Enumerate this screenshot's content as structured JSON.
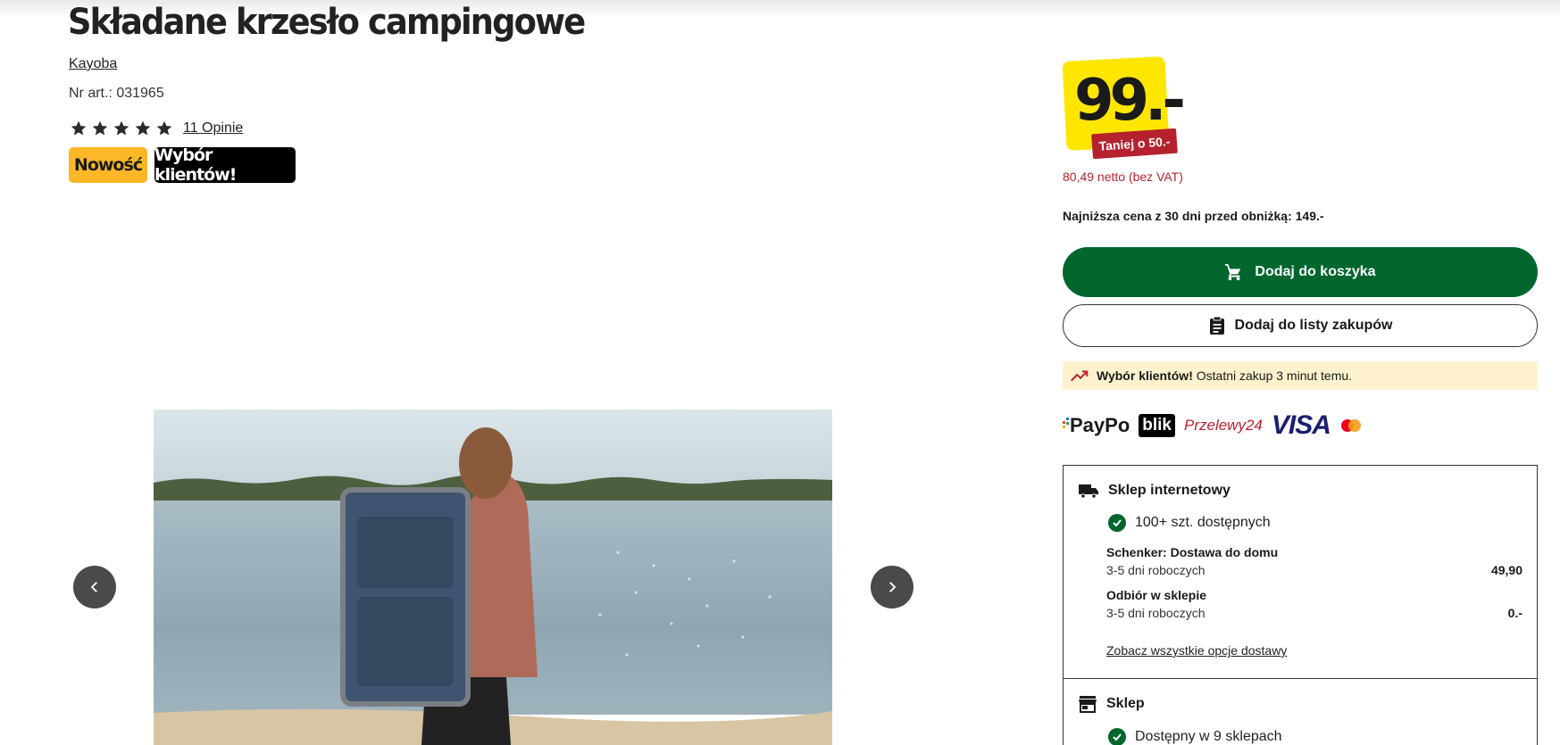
{
  "product": {
    "title": "Składane krzesło campingowe",
    "brand": "Kayoba",
    "article_number": "Nr art.: 031965",
    "rating": 5,
    "reviews_label": "11 Opinie",
    "badges": {
      "new": "Nowość",
      "choice": "Wybór klientów!"
    }
  },
  "price": {
    "value": "99.-",
    "cheaper_label": "Taniej o 50.-",
    "netto": "80,49 netto (bez VAT)",
    "lowest_30_days": "Najniższa cena z 30 dni przed obniżką: 149.-"
  },
  "actions": {
    "add_to_cart": "Dodaj do koszyka",
    "add_to_list": "Dodaj do listy zakupów"
  },
  "notice": {
    "bold": "Wybór klientów!",
    "text": "Ostatni zakup 3 minut temu."
  },
  "payments": {
    "paypo": "PayPo",
    "blik": "blik",
    "przelewy24": "Przelewy24",
    "visa": "VISA",
    "mastercard_icon": "mastercard-logo"
  },
  "online_store": {
    "heading": "Sklep internetowy",
    "availability": "100+ szt. dostępnych",
    "options": [
      {
        "name": "Schenker: Dostawa do domu",
        "time": "3-5 dni roboczych",
        "price": "49,90"
      },
      {
        "name": "Odbiór w sklepie",
        "time": "3-5 dni roboczych",
        "price": "0.-"
      }
    ],
    "see_all": "Zobacz wszystkie opcje dostawy"
  },
  "store": {
    "heading": "Sklep",
    "availability": "Dostępny w 9 sklepach"
  },
  "colors": {
    "brand_green": "#00662e",
    "price_yellow": "#ffe600",
    "discount_red": "#b5222e",
    "badge_yellow": "#fbb726",
    "notice_bg": "#fdf2cd"
  },
  "icons": {
    "cart": "cart-icon",
    "list": "clipboard-icon",
    "trend": "trending-up-icon",
    "truck": "truck-icon",
    "store": "store-icon",
    "check": "check-circle-icon",
    "prev": "chevron-left-icon",
    "next": "chevron-right-icon"
  }
}
